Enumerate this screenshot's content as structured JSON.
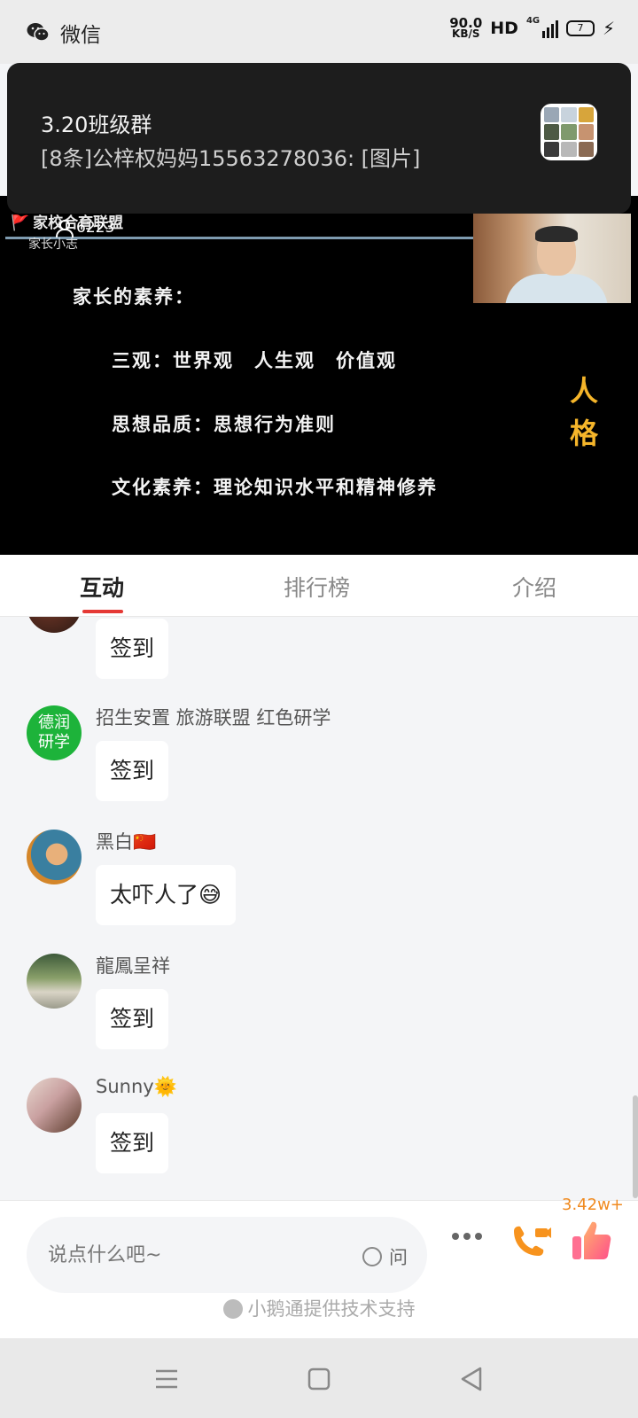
{
  "status_bar": {
    "app_name": "微信",
    "net_speed": "90.0",
    "net_speed_unit": "KB/S",
    "hd": "HD",
    "network": "4G",
    "battery": "7"
  },
  "notification": {
    "title": "3.20班级群",
    "message": "[8条]公梓权妈妈15563278036: [图片]",
    "avatar_icon": "group-avatar"
  },
  "video": {
    "brand": "家校合育联盟",
    "subtitle": "家长小志",
    "viewer_count": "6223",
    "slide": {
      "heading": "家长的素养：",
      "line1": "三观：世界观　人生观　价值观",
      "line2": "思想品质：思想行为准则",
      "line3": "文化素养：理论知识水平和精神修养",
      "side_text": "人格"
    }
  },
  "tabs": [
    {
      "label": "互动",
      "active": true
    },
    {
      "label": "排行榜",
      "active": false
    },
    {
      "label": "介绍",
      "active": false
    }
  ],
  "messages": [
    {
      "name": "",
      "text": "签到"
    },
    {
      "name": "招生安置 旅游联盟 红色研学",
      "text": "签到",
      "avatar_text": "德润研学"
    },
    {
      "name": "黑白🇨🇳",
      "text": "太吓人了😅"
    },
    {
      "name": "龍鳳呈祥",
      "text": "签到"
    },
    {
      "name": "Sunny🌞",
      "text": "签到"
    }
  ],
  "input": {
    "placeholder": "说点什么吧~",
    "ask_label": "问"
  },
  "like_count": "3.42w+",
  "powered_by": "小鹅通提供技术支持",
  "colors": {
    "accent_red": "#e53935",
    "like_orange": "#f08a1f",
    "slide_gold": "#f5b52a"
  }
}
